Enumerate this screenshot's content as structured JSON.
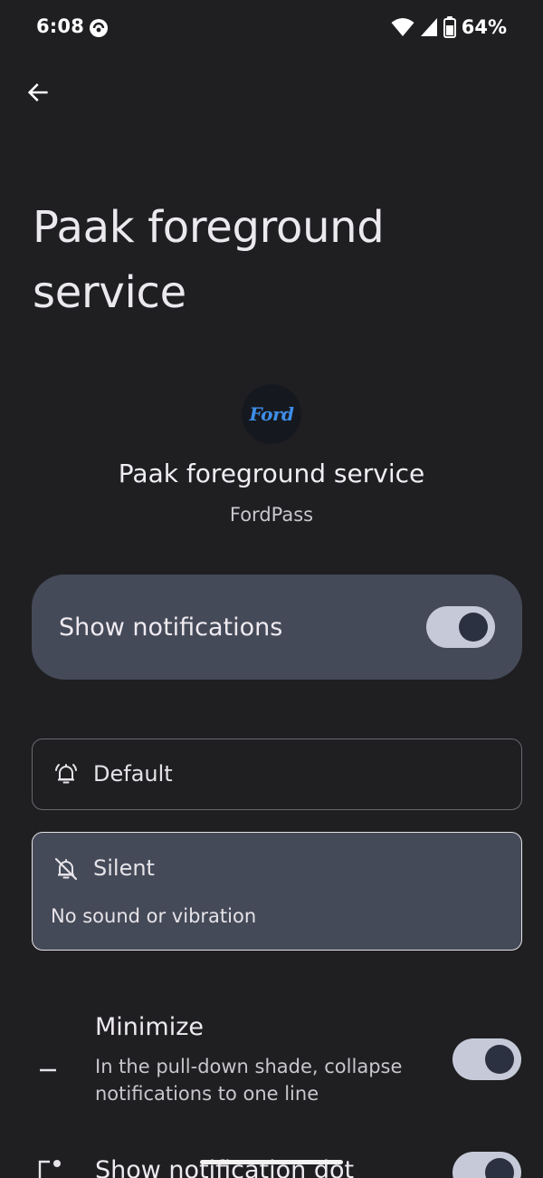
{
  "status_bar": {
    "time": "6:08",
    "battery_percent": "64%"
  },
  "page": {
    "title": "Paak foreground service"
  },
  "app_header": {
    "logo_text": "Ford",
    "channel_name": "Paak foreground service",
    "app_name": "FordPass"
  },
  "show_notifications": {
    "label": "Show notifications",
    "enabled": true
  },
  "options": {
    "default": {
      "label": "Default",
      "selected": false
    },
    "silent": {
      "label": "Silent",
      "description": "No sound or vibration",
      "selected": true
    }
  },
  "settings": {
    "minimize": {
      "title": "Minimize",
      "description": "In the pull-down shade, collapse notifications to one line",
      "enabled": true
    },
    "notification_dot": {
      "title": "Show notification dot",
      "enabled": true
    }
  },
  "colors": {
    "background": "#1f1f22",
    "card": "#454a58",
    "toggle_track": "#c6cad8",
    "toggle_knob": "#2b3140",
    "ford_blue": "#3d8ee8"
  },
  "icons": {
    "status": [
      "app-status-icon",
      "wifi-icon",
      "signal-icon",
      "battery-icon"
    ],
    "back": "arrow-left-icon",
    "default": "bell-icon",
    "silent": "bell-off-icon",
    "minimize": "minimize-icon",
    "dot": "notification-dot-icon"
  }
}
